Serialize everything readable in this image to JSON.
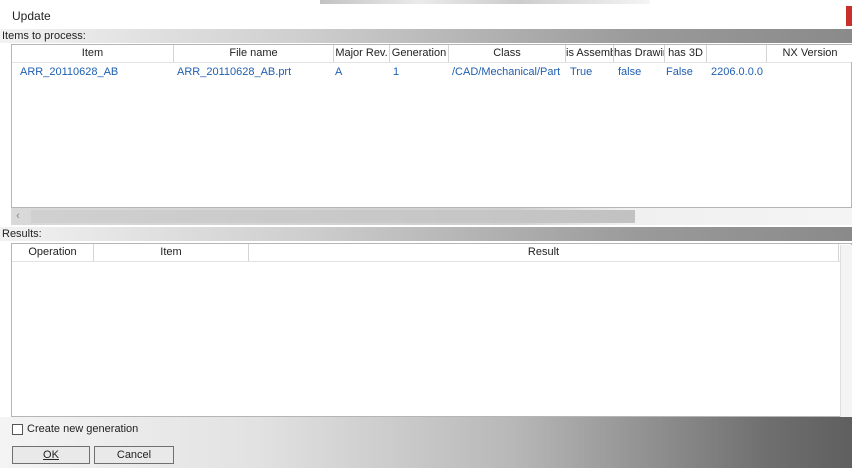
{
  "window": {
    "title": "Update"
  },
  "items_section": {
    "label": "Items to process:",
    "columns": [
      "Item",
      "File name",
      "Major Rev.",
      "Generation",
      "Class",
      "is Assembl",
      "has Drawir",
      "has 3D",
      "",
      "NX Version"
    ],
    "rows": [
      [
        "ARR_20110628_AB",
        "ARR_20110628_AB.prt",
        "A",
        "1",
        "/CAD/Mechanical/Part",
        "True",
        "false",
        "False",
        "2206.0.0.0",
        ""
      ]
    ]
  },
  "results_section": {
    "label": "Results:",
    "columns": [
      "Operation",
      "Item",
      "Result"
    ]
  },
  "scroll": {
    "left_arrow": "‹"
  },
  "options": {
    "create_new_generation_label": "Create new generation",
    "create_new_generation_checked": false
  },
  "buttons": {
    "ok_label": "OK",
    "cancel_label": "Cancel"
  },
  "colors": {
    "link_text": "#1f5fb0",
    "close_button": "#c9302c"
  }
}
